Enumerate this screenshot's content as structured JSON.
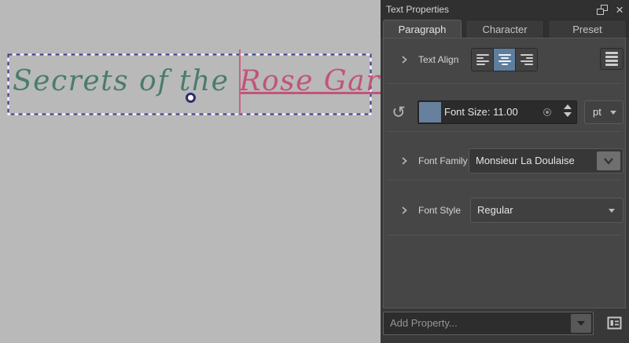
{
  "window": {
    "title": "Text Properties"
  },
  "tabs": [
    {
      "label": "Paragraph",
      "active": true
    },
    {
      "label": "Character",
      "active": false
    },
    {
      "label": "Preset",
      "active": false
    }
  ],
  "properties": {
    "text_align": {
      "label": "Text Align",
      "selected": "center"
    },
    "font_size": {
      "display": "Font Size: 11.00",
      "value": 11.0,
      "unit": "pt"
    },
    "font_family": {
      "label": "Font Family",
      "value": "Monsieur La Doulaise"
    },
    "font_style": {
      "label": "Font Style",
      "value": "Regular"
    }
  },
  "footer": {
    "add_property_placeholder": "Add Property..."
  },
  "canvas": {
    "text_segments": [
      {
        "text": "Secrets of the ",
        "color": "#4a7c6d"
      },
      {
        "text": "Rose Garden",
        "color": "#c05578",
        "underline": true
      }
    ],
    "caret_color": "#cf5e84",
    "selection_dash_color": "#3d3d8f",
    "background": "#b9b9b9"
  },
  "colors": {
    "accent_selected": "#5d7e9e",
    "font_size_fill": "#66809e",
    "panel_bg": "#383838",
    "content_bg": "#464646",
    "handle_border": "#2d2d70"
  },
  "icons": {
    "float": "float-window-icon",
    "close": "×",
    "undo": "↺",
    "align_left": "align-left-icon",
    "align_center": "align-center-icon",
    "align_right": "align-right-icon",
    "justify": "justify-icon",
    "dropdown": "chevron-down-icon",
    "spin_link": "circle-dot-icon",
    "property_list": "list-box-icon"
  }
}
